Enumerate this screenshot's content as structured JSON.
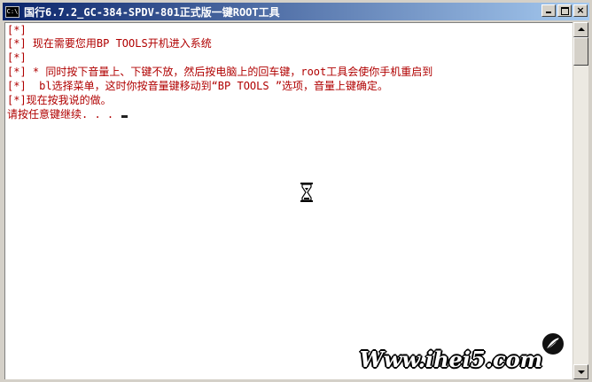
{
  "window": {
    "title": "国行6.7.2_GC-384-SPDV-801正式版一键ROOT工具",
    "icon_label": "C:\\",
    "close_glyph": "×"
  },
  "console": {
    "lines": [
      "[*]",
      "[*] 现在需要您用BP TOOLS开机进入系统",
      "[*]",
      "[*] * 同时按下音量上、下键不放，然后按电脑上的回车键，root工具会使你手机重启到",
      "[*]  bl选择菜单，这时你按音量键移动到“BP TOOLS ”选项，音量上键确定。",
      "[*]现在按我说的做。",
      "请按任意键继续. . . "
    ],
    "text_color": "#b00000"
  },
  "watermark": {
    "text": "Www.ihei5.com"
  },
  "icons": {
    "app": "console-icon",
    "busy": "hourglass-icon",
    "logo": "feather-logo-icon"
  }
}
